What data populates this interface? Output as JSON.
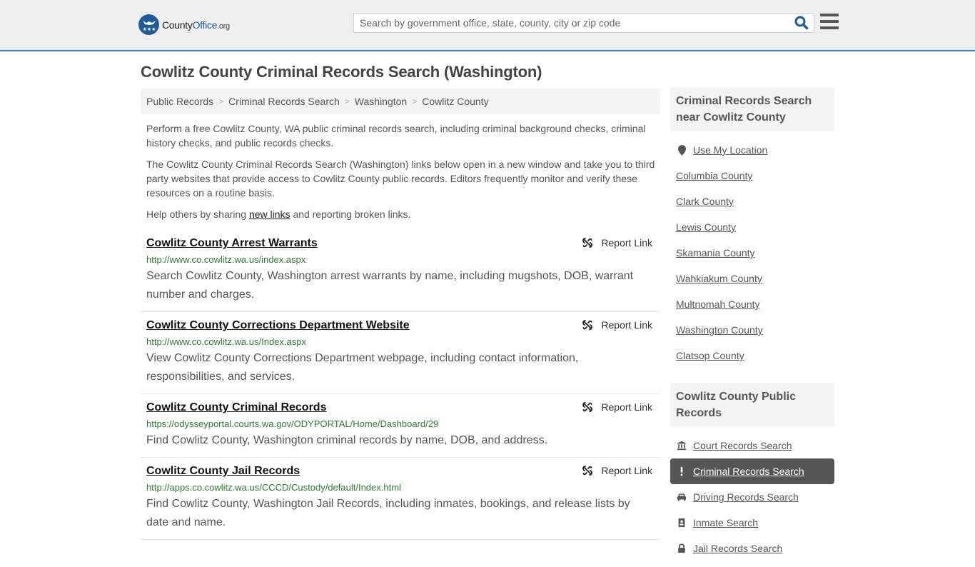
{
  "header": {
    "logo": {
      "name_part1": "County",
      "name_part2": "Office",
      "tld": ".org"
    },
    "search": {
      "placeholder": "Search by government office, state, county, city or zip code",
      "value": ""
    },
    "search_icon": "search-icon",
    "menu_icon": "hamburger-menu-icon"
  },
  "page": {
    "title": "Cowlitz County Criminal Records Search (Washington)",
    "breadcrumb": [
      "Public Records",
      "Criminal Records Search",
      "Washington",
      "Cowlitz County"
    ],
    "breadcrumb_separator": ">",
    "intro": {
      "p1": "Perform a free Cowlitz County, WA public criminal records search, including criminal background checks, criminal history checks, and public records checks.",
      "p2": "The Cowlitz County Criminal Records Search (Washington) links below open in a new window and take you to third party websites that provide access to Cowlitz County public records. Editors frequently monitor and verify these resources on a routine basis.",
      "p3_before": "Help others by sharing ",
      "p3_link": "new links",
      "p3_after": " and reporting broken links."
    }
  },
  "listings": [
    {
      "title": "Cowlitz County Arrest Warrants",
      "url": "http://www.co.cowlitz.wa.us/index.aspx",
      "description": "Search Cowlitz County, Washington arrest warrants by name, including mugshots, DOB, warrant number and charges.",
      "report_label": "Report Link"
    },
    {
      "title": "Cowlitz County Corrections Department Website",
      "url": "http://www.co.cowlitz.wa.us/Index.aspx",
      "description": "View Cowlitz County Corrections Department webpage, including contact information, responsibilities, and services.",
      "report_label": "Report Link"
    },
    {
      "title": "Cowlitz County Criminal Records",
      "url": "https://odysseyportal.courts.wa.gov/ODYPORTAL/Home/Dashboard/29",
      "description": "Find Cowlitz County, Washington criminal records by name, DOB, and address.",
      "report_label": "Report Link"
    },
    {
      "title": "Cowlitz County Jail Records",
      "url": "http://apps.co.cowlitz.wa.us/CCCD/Custody/default/Index.html",
      "description": "Find Cowlitz County, Washington Jail Records, including inmates, bookings, and release lists by date and name.",
      "report_label": "Report Link"
    }
  ],
  "sidebar": {
    "nearby": {
      "heading": "Criminal Records Search near Cowlitz County",
      "use_location": "Use My Location",
      "counties": [
        "Columbia County",
        "Clark County",
        "Lewis County",
        "Skamania County",
        "Wahkiakum County",
        "Multnomah County",
        "Washington County",
        "Clatsop County"
      ]
    },
    "public_records": {
      "heading": "Cowlitz County Public Records",
      "items": [
        {
          "label": "Court Records Search",
          "icon": "courthouse-icon",
          "active": false
        },
        {
          "label": "Criminal Records Search",
          "icon": "exclamation-icon",
          "active": true
        },
        {
          "label": "Driving Records Search",
          "icon": "car-icon",
          "active": false
        },
        {
          "label": "Inmate Search",
          "icon": "id-badge-icon",
          "active": false
        },
        {
          "label": "Jail Records Search",
          "icon": "lock-icon",
          "active": false
        }
      ]
    }
  },
  "colors": {
    "brand_blue": "#1e5b9a",
    "header_border": "#3a7fb0",
    "url_green": "#2e7d32",
    "active_item_bg": "#555555"
  }
}
